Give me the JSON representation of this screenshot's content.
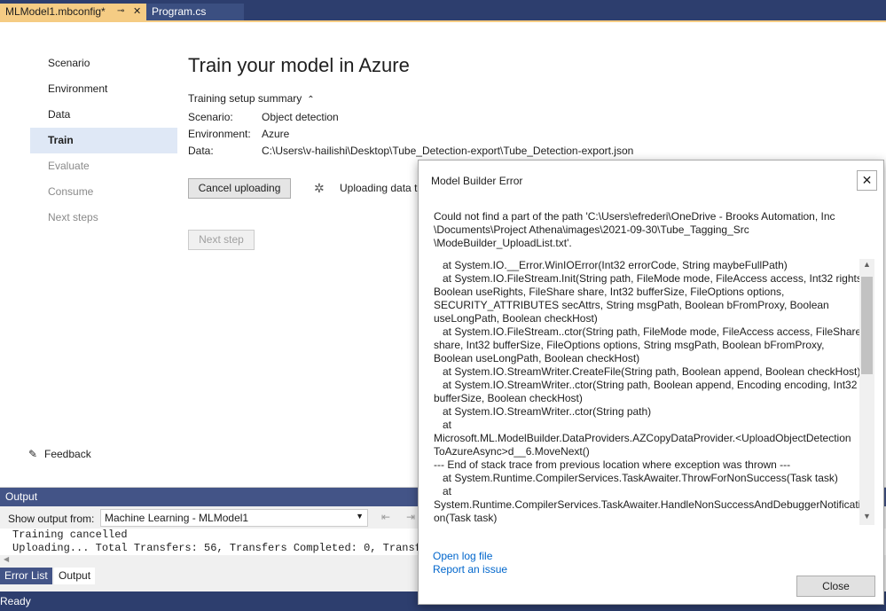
{
  "tabs": {
    "active": {
      "label": "MLModel1.mbconfig*",
      "pin_glyph": "⊸",
      "close_glyph": "✕"
    },
    "other": {
      "label": "Program.cs"
    }
  },
  "nav": {
    "items": [
      {
        "label": "Scenario"
      },
      {
        "label": "Environment"
      },
      {
        "label": "Data"
      },
      {
        "label": "Train"
      },
      {
        "label": "Evaluate"
      },
      {
        "label": "Consume"
      },
      {
        "label": "Next steps"
      }
    ],
    "feedback_label": "Feedback"
  },
  "main": {
    "title": "Train your model in Azure",
    "summary_toggle": "Training setup summary",
    "summary": {
      "scenario_label": "Scenario:",
      "scenario_value": "Object detection",
      "environment_label": "Environment:",
      "environment_value": "Azure",
      "data_label": "Data:",
      "data_value": "C:\\Users\\v-hailishi\\Desktop\\Tube_Detection-export\\Tube_Detection-export.json"
    },
    "cancel_button": "Cancel uploading",
    "upload_status": "Uploading data t",
    "next_button": "Next step"
  },
  "output": {
    "header": "Output",
    "show_from_label": "Show output from:",
    "source_value": "Machine Learning - MLModel1",
    "lines": [
      "Training cancelled",
      "Uploading... Total Transfers: 56, Transfers Completed: 0, Transfer"
    ],
    "bottom_tabs": [
      "Error List",
      "Output"
    ]
  },
  "status_bar": {
    "text": "Ready"
  },
  "dialog": {
    "title": "Model Builder Error",
    "close_glyph": "✕",
    "message": "Could not find a part of the path 'C:\\Users\\efrederi\\OneDrive - Brooks Automation, Inc\n\\Documents\\Project Athena\\images\\2021-09-30\\Tube_Tagging_Src\n\\ModeBuilder_UploadList.txt'.",
    "stack_trace": "   at System.IO.__Error.WinIOError(Int32 errorCode, String maybeFullPath)\n   at System.IO.FileStream.Init(String path, FileMode mode, FileAccess access, Int32 rights,\nBoolean useRights, FileShare share, Int32 bufferSize, FileOptions options,\nSECURITY_ATTRIBUTES secAttrs, String msgPath, Boolean bFromProxy, Boolean\nuseLongPath, Boolean checkHost)\n   at System.IO.FileStream..ctor(String path, FileMode mode, FileAccess access, FileShare\nshare, Int32 bufferSize, FileOptions options, String msgPath, Boolean bFromProxy,\nBoolean useLongPath, Boolean checkHost)\n   at System.IO.StreamWriter.CreateFile(String path, Boolean append, Boolean checkHost)\n   at System.IO.StreamWriter..ctor(String path, Boolean append, Encoding encoding, Int32\nbufferSize, Boolean checkHost)\n   at System.IO.StreamWriter..ctor(String path)\n   at\nMicrosoft.ML.ModelBuilder.DataProviders.AZCopyDataProvider.<UploadObjectDetection\nToAzureAsync>d__6.MoveNext()\n--- End of stack trace from previous location where exception was thrown ---\n   at System.Runtime.CompilerServices.TaskAwaiter.ThrowForNonSuccess(Task task)\n   at\nSystem.Runtime.CompilerServices.TaskAwaiter.HandleNonSuccessAndDebuggerNotificati\non(Task task)",
    "open_log_link": "Open log file",
    "report_issue_link": "Report an issue",
    "close_button": "Close"
  },
  "colors": {
    "active_tab": "#f5cc84",
    "chrome_blue": "#2d3e6e",
    "link": "#0066cc",
    "nav_selected": "#dfe8f6"
  }
}
